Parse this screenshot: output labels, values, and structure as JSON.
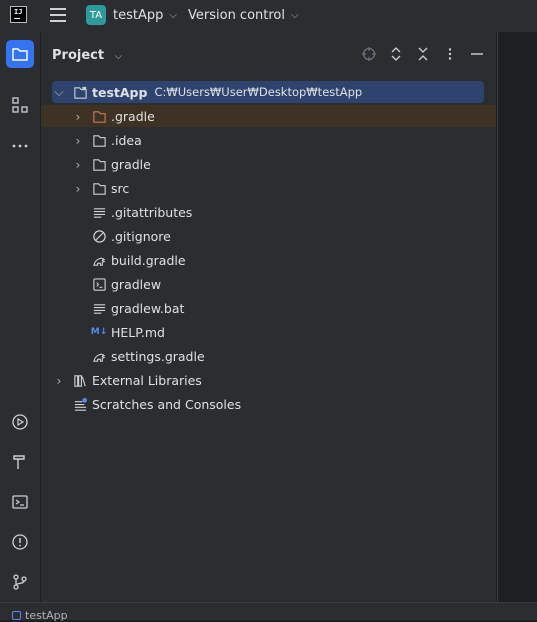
{
  "topbar": {
    "logo_text": "IJ",
    "project_badge": "TA",
    "project_name": "testApp",
    "vcs_label": "Version control"
  },
  "panel": {
    "title": "Project"
  },
  "tree": {
    "root": {
      "name": "testApp",
      "path": "C:₩Users₩User₩Desktop₩testApp"
    },
    "items": [
      {
        "label": ".gradle",
        "icon": "folder-icon-orange"
      },
      {
        "label": ".idea",
        "icon": "folder-icon"
      },
      {
        "label": "gradle",
        "icon": "folder-icon"
      },
      {
        "label": "src",
        "icon": "folder-icon"
      },
      {
        "label": ".gitattributes",
        "icon": "text-file-icon"
      },
      {
        "label": ".gitignore",
        "icon": "ignore-file-icon"
      },
      {
        "label": "build.gradle",
        "icon": "gradle-icon"
      },
      {
        "label": "gradlew",
        "icon": "shell-script-icon"
      },
      {
        "label": "gradlew.bat",
        "icon": "text-file-icon"
      },
      {
        "label": "HELP.md",
        "icon": "markdown-icon"
      },
      {
        "label": "settings.gradle",
        "icon": "gradle-icon"
      }
    ],
    "external_libraries": "External Libraries",
    "scratches": "Scratches and Consoles",
    "markdown_icon_text": "M↓"
  },
  "statusbar": {
    "project": "testApp"
  },
  "colors": {
    "accent": "#3574f0",
    "selection": "#2e436e",
    "folder_orange": "#c77d55"
  }
}
